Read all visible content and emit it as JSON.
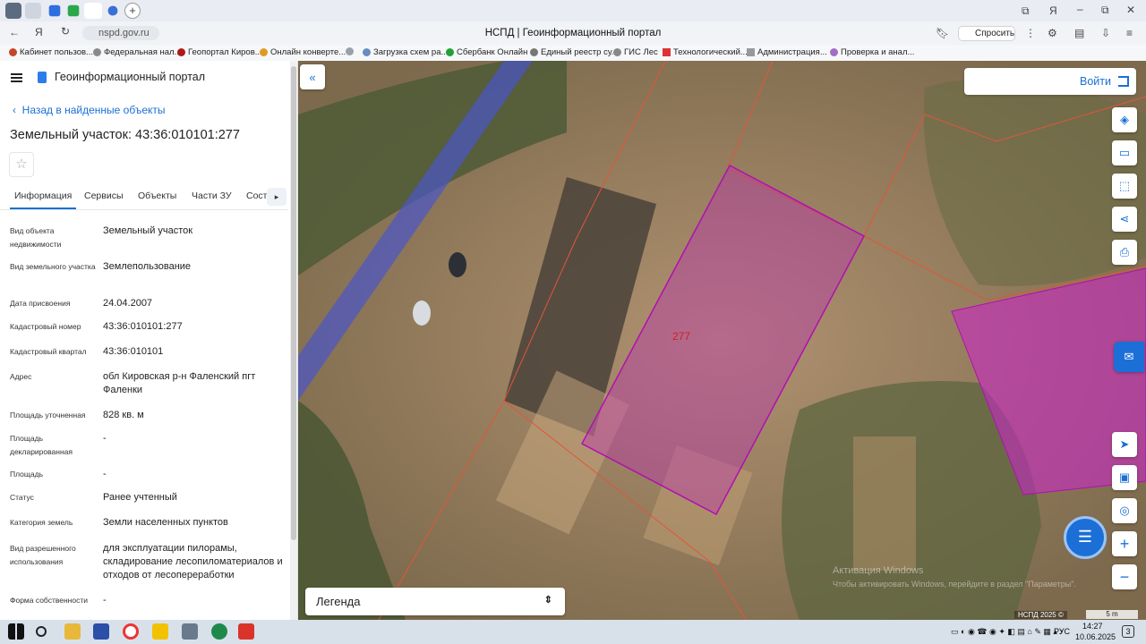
{
  "browser": {
    "url": "nspd.gov.ru",
    "page_title": "НСПД | Геоинформационный портал",
    "ask_label": "Спросить",
    "bookmarks": [
      "Кабинет пользов...",
      "Федеральная нал...",
      "Геопортал Киров...",
      "Онлайн конверте...",
      "Загрузка схем ра...",
      "Сбербанк Онлайн",
      "Единый реестр су...",
      "ГИС Лес",
      "Технологический...",
      "Администрация...",
      "Проверка и анал..."
    ]
  },
  "panel": {
    "portal_name": "Геоинформационный портал",
    "back_link": "Назад в найденные объекты",
    "title": "Земельный участок: 43:36:010101:277",
    "tabs": [
      "Информация",
      "Сервисы",
      "Объекты",
      "Части ЗУ",
      "Соста..."
    ],
    "fields": [
      {
        "label": "Вид объекта недвижимости",
        "value": "Земельный участок"
      },
      {
        "label": "Вид земельного участка",
        "value": "Землепользование"
      },
      {
        "label": "Дата присвоения",
        "value": "24.04.2007"
      },
      {
        "label": "Кадастровый номер",
        "value": "43:36:010101:277"
      },
      {
        "label": "Кадастровый квартал",
        "value": "43:36:010101"
      },
      {
        "label": "Адрес",
        "value": "обл Кировская р-н Фаленский пгт Фаленки"
      },
      {
        "label": "Площадь уточненная",
        "value": "828 кв. м"
      },
      {
        "label": "Площадь декларированная",
        "value": "-"
      },
      {
        "label": "Площадь",
        "value": "-"
      },
      {
        "label": "Статус",
        "value": "Ранее учтенный"
      },
      {
        "label": "Категория земель",
        "value": "Земли населенных пунктов"
      },
      {
        "label": "Вид разрешенного использования",
        "value": "для эксплуатации пилорамы, складирование лесопиломатериалов и отходов от лесопереработки"
      },
      {
        "label": "Форма собственности",
        "value": "-"
      }
    ]
  },
  "map": {
    "login_label": "Войти",
    "legend_label": "Легенда",
    "parcel_label": "277",
    "watermark_title": "Активация Windows",
    "watermark_text": "Чтобы активировать Windows, перейдите в раздел \"Параметры\".",
    "copyright": "НСПД 2025 ©",
    "scale": "5 m"
  },
  "taskbar": {
    "lang": "РУС",
    "time": "14:27",
    "date": "10.06.2025",
    "notif_count": "3"
  },
  "colors": {
    "accent": "#1b6fd6",
    "parcel_fill": "#c020c0",
    "boundary": "#e2553a"
  }
}
